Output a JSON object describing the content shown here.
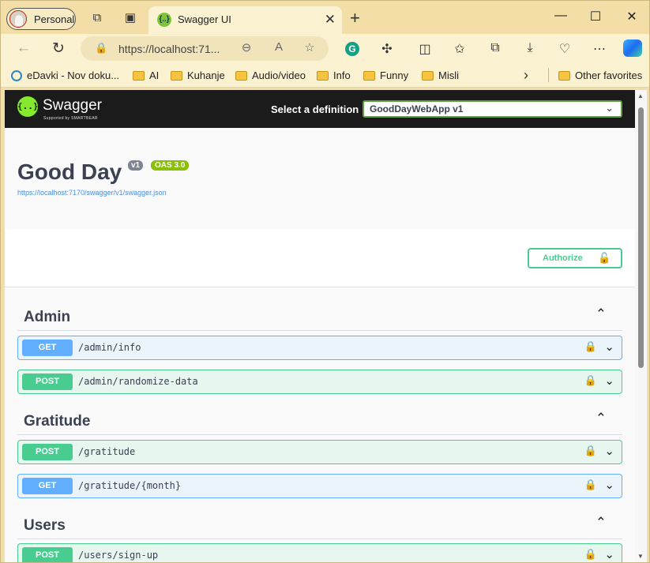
{
  "browser": {
    "profile_name": "Personal",
    "tab_title": "Swagger UI",
    "tab_favicon": "{..}",
    "url": "https://localhost:71...",
    "bookmarks": [
      {
        "label": "eDavki - Nov doku...",
        "icon": "edavki-icon"
      },
      {
        "label": "AI",
        "icon": "folder-icon"
      },
      {
        "label": "Kuhanje",
        "icon": "folder-icon"
      },
      {
        "label": "Audio/video",
        "icon": "folder-icon"
      },
      {
        "label": "Info",
        "icon": "folder-icon"
      },
      {
        "label": "Funny",
        "icon": "folder-icon"
      },
      {
        "label": "Misli",
        "icon": "folder-icon"
      }
    ],
    "other_favorites": "Other favorites",
    "colors": {
      "chrome": "#f2dea6",
      "toolbar": "#fbf2d2"
    }
  },
  "swagger": {
    "brand": "Swagger",
    "brand_sub": "Supported by SMARTBEAR",
    "select_label": "Select a definition",
    "selected_definition": "GoodDayWebApp v1",
    "colors": {
      "topbar": "#1b1b1b",
      "get": "#61affe",
      "post": "#49cc90",
      "logo": "#85ea2d"
    }
  },
  "info": {
    "title": "Good Day",
    "version_badge": "v1",
    "oas_badge": "OAS 3.0",
    "spec_link": "https://localhost:7170/swagger/v1/swagger.json"
  },
  "authorize_label": "Authorize",
  "tags": [
    {
      "name": "Admin",
      "operations": [
        {
          "method": "GET",
          "path": "/admin/info"
        },
        {
          "method": "POST",
          "path": "/admin/randomize-data"
        }
      ]
    },
    {
      "name": "Gratitude",
      "operations": [
        {
          "method": "POST",
          "path": "/gratitude"
        },
        {
          "method": "GET",
          "path": "/gratitude/{month}"
        }
      ]
    },
    {
      "name": "Users",
      "operations": [
        {
          "method": "POST",
          "path": "/users/sign-up"
        }
      ]
    }
  ]
}
